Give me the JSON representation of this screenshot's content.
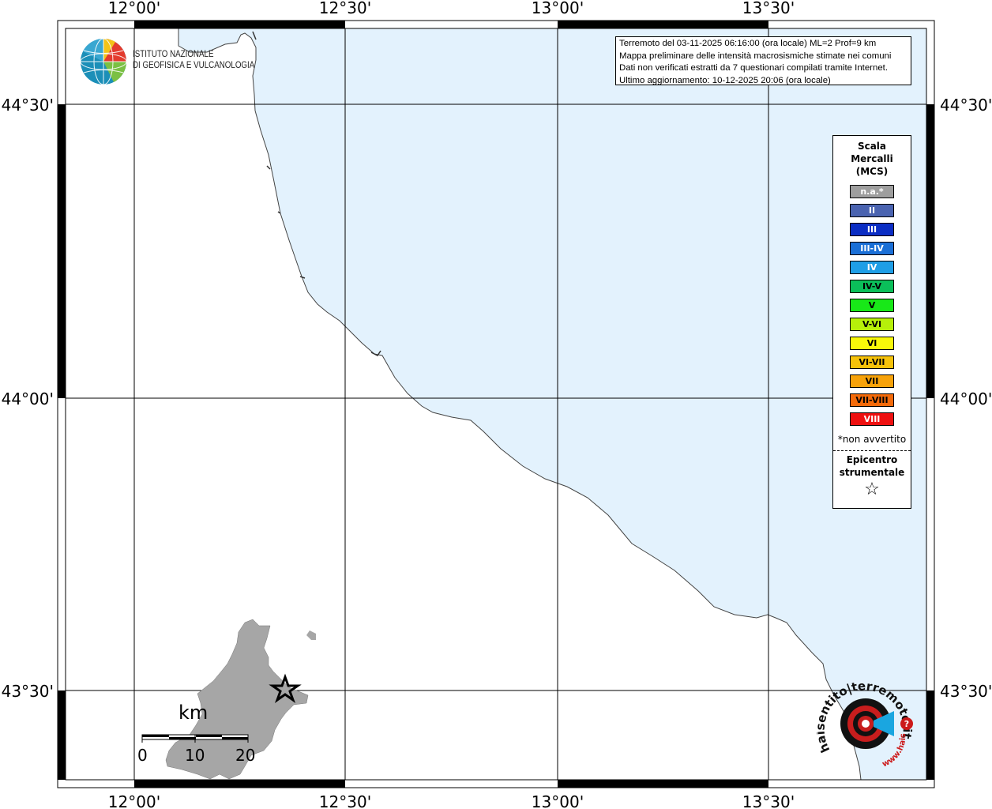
{
  "info": {
    "line1": "Terremoto del 03-11-2025 06:16:00 (ora locale) ML=2 Prof=9 km",
    "line2": "Mappa preliminare delle intensità macrosismiche stimate nei comuni",
    "line3": "Dati non verificati estratti da 7 questionari compilati tramite Internet.",
    "line4": "Ultimo aggiornamento: 10-12-2025 20:06 (ora locale)"
  },
  "ingv": {
    "line1": "ISTITUTO NAZIONALE",
    "line2": "DI GEOFISICA E VULCANOLOGIA"
  },
  "ticks": {
    "lon": [
      "12°00'",
      "12°30'",
      "13°00'",
      "13°30'"
    ],
    "lat": [
      "44°30'",
      "44°00'",
      "43°30'"
    ]
  },
  "legend": {
    "title1": "Scala",
    "title2": "Mercalli",
    "title3": "(MCS)",
    "levels": [
      {
        "label": "n.a.*",
        "color": "#9e9e9e",
        "text": "#ffffff"
      },
      {
        "label": "II",
        "color": "#4a63b0",
        "text": "#ffffff"
      },
      {
        "label": "III",
        "color": "#0b2dc4",
        "text": "#ffffff"
      },
      {
        "label": "III-IV",
        "color": "#1a6fd6",
        "text": "#ffffff"
      },
      {
        "label": "IV",
        "color": "#1e9ee6",
        "text": "#ffffff"
      },
      {
        "label": "IV-V",
        "color": "#0bbf5a",
        "text": "#000000"
      },
      {
        "label": "V",
        "color": "#18e818",
        "text": "#000000"
      },
      {
        "label": "V-VI",
        "color": "#b6f00a",
        "text": "#000000"
      },
      {
        "label": "VI",
        "color": "#f8f80a",
        "text": "#000000"
      },
      {
        "label": "VI-VII",
        "color": "#f6c20a",
        "text": "#000000"
      },
      {
        "label": "VII",
        "color": "#f7a20a",
        "text": "#000000"
      },
      {
        "label": "VII-VIII",
        "color": "#f36a0a",
        "text": "#000000"
      },
      {
        "label": "VIII",
        "color": "#ee1010",
        "text": "#ffffff"
      }
    ],
    "na_note": "*non avvertito",
    "epi1": "Epicentro",
    "epi2": "strumentale",
    "epi_symbol": "☆"
  },
  "scalebar": {
    "unit": "km",
    "ticks": [
      "0",
      "10",
      "20"
    ]
  },
  "sea_color": "#e3f2fd",
  "logo": {
    "text": "haisentito|terremoto.it www.haisentito.it",
    "accent": "#cc1a1a"
  }
}
